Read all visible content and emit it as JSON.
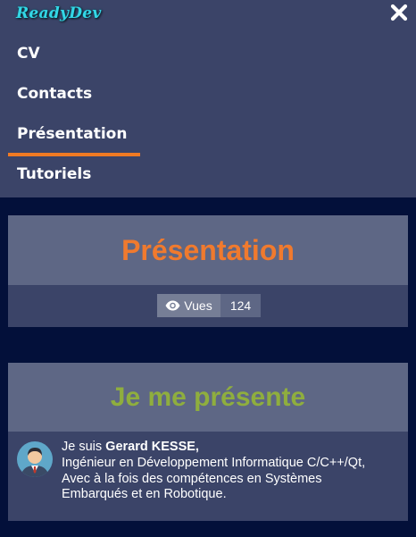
{
  "header": {
    "logo": "ReadyDev",
    "close_icon": "close-icon"
  },
  "nav": {
    "items": [
      {
        "label": "CV"
      },
      {
        "label": "Contacts"
      },
      {
        "label": "Présentation",
        "active": true
      },
      {
        "label": "Tutoriels"
      }
    ]
  },
  "presentation_card": {
    "title": "Présentation",
    "views_icon": "eye-icon",
    "views_label": "Vues",
    "views_count": "124"
  },
  "intro_card": {
    "title": "Je me présente",
    "greeting": "Je suis ",
    "name": "Gerard KESSE,",
    "line2": "Ingénieur en Développement Informatique C/C++/Qt,",
    "line3": "Avec à la fois des compétences en Systèmes",
    "line4": "Embarqués et en Robotique."
  },
  "colors": {
    "accent": "#f07a2e",
    "green_title": "#8fae3e",
    "logo": "#33d7e6",
    "panel": "#3b4468",
    "page_bg": "#03103a"
  }
}
